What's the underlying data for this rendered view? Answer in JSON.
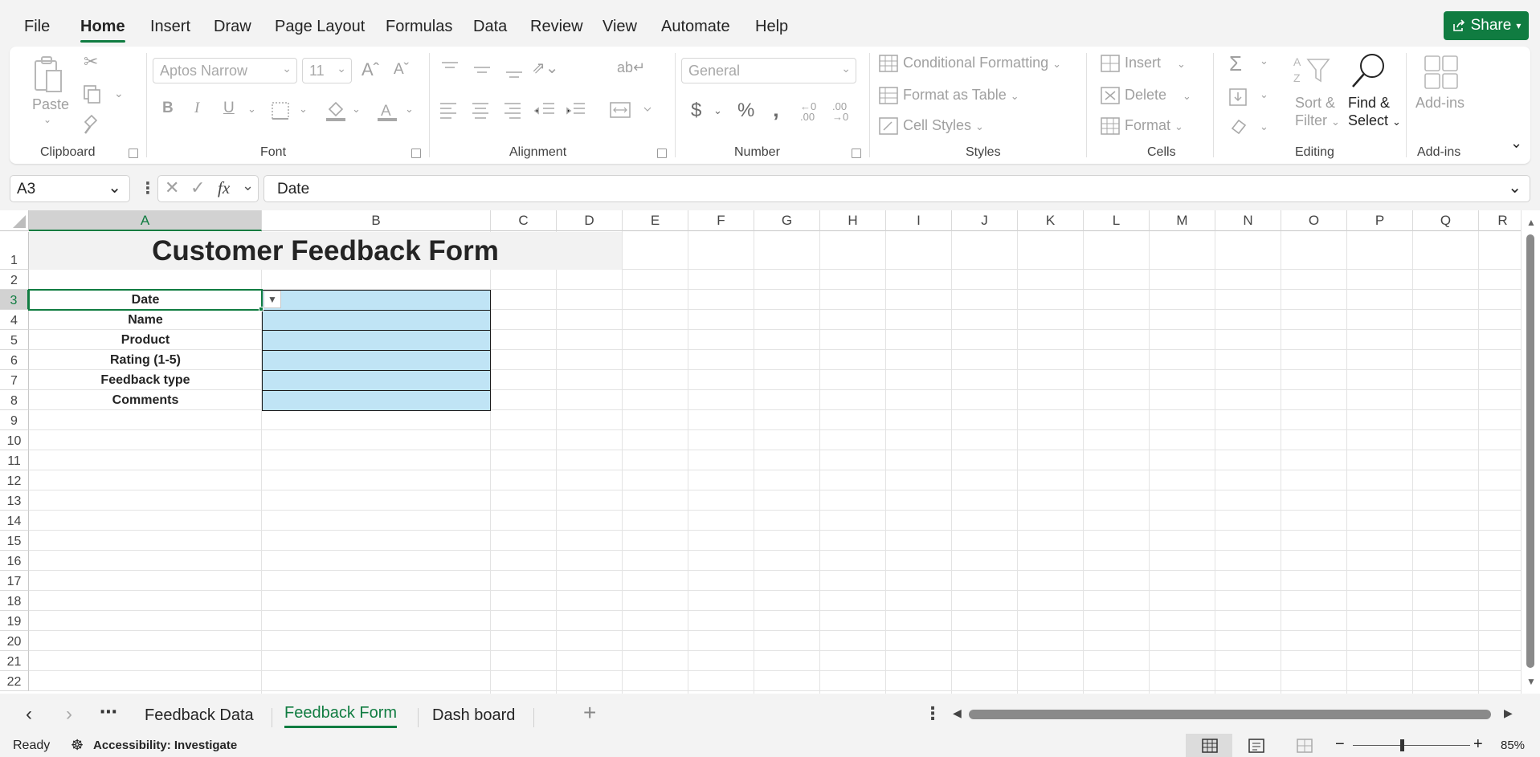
{
  "menu": {
    "tabs": [
      "File",
      "Home",
      "Insert",
      "Draw",
      "Page Layout",
      "Formulas",
      "Data",
      "Review",
      "View",
      "Automate",
      "Help"
    ],
    "share_label": "Share"
  },
  "ribbon": {
    "clipboard": {
      "label": "Clipboard",
      "paste": "Paste"
    },
    "font": {
      "label": "Font",
      "font_name": "Aptos Narrow",
      "font_size": "11"
    },
    "alignment": {
      "label": "Alignment"
    },
    "number": {
      "label": "Number",
      "format": "General"
    },
    "styles": {
      "label": "Styles",
      "conditional": "Conditional Formatting",
      "format_table": "Format as Table",
      "cell_styles": "Cell Styles"
    },
    "cells": {
      "label": "Cells",
      "insert": "Insert",
      "delete": "Delete",
      "format": "Format"
    },
    "editing": {
      "label": "Editing",
      "sort1": "Sort &",
      "sort2": "Filter",
      "find1": "Find &",
      "find2": "Select"
    },
    "addins": {
      "label": "Add-ins",
      "addins_btn": "Add-ins"
    }
  },
  "formula_bar": {
    "name_box": "A3",
    "fx": "fx",
    "value": "Date"
  },
  "grid": {
    "columns": [
      "A",
      "B",
      "C",
      "D",
      "E",
      "F",
      "G",
      "H",
      "I",
      "J",
      "K",
      "L",
      "M",
      "N",
      "O",
      "P",
      "Q",
      "R"
    ],
    "rows": [
      "1",
      "2",
      "3",
      "4",
      "5",
      "6",
      "7",
      "8",
      "9",
      "10",
      "11",
      "12",
      "13",
      "14",
      "15",
      "16",
      "17",
      "18",
      "19",
      "20",
      "21",
      "22"
    ],
    "title": "Customer Feedback Form",
    "labels": [
      "Date",
      "Name",
      "Product",
      "Rating (1-5)",
      "Feedback type",
      "Comments"
    ]
  },
  "sheets": {
    "tabs": [
      "Feedback Data",
      "Feedback Form",
      "Dash board"
    ],
    "active": "Feedback Form"
  },
  "status": {
    "ready": "Ready",
    "accessibility": "Accessibility: Investigate",
    "zoom": "85%"
  },
  "colors": {
    "accent": "#107c41",
    "input_fill": "#c0e4f5"
  }
}
